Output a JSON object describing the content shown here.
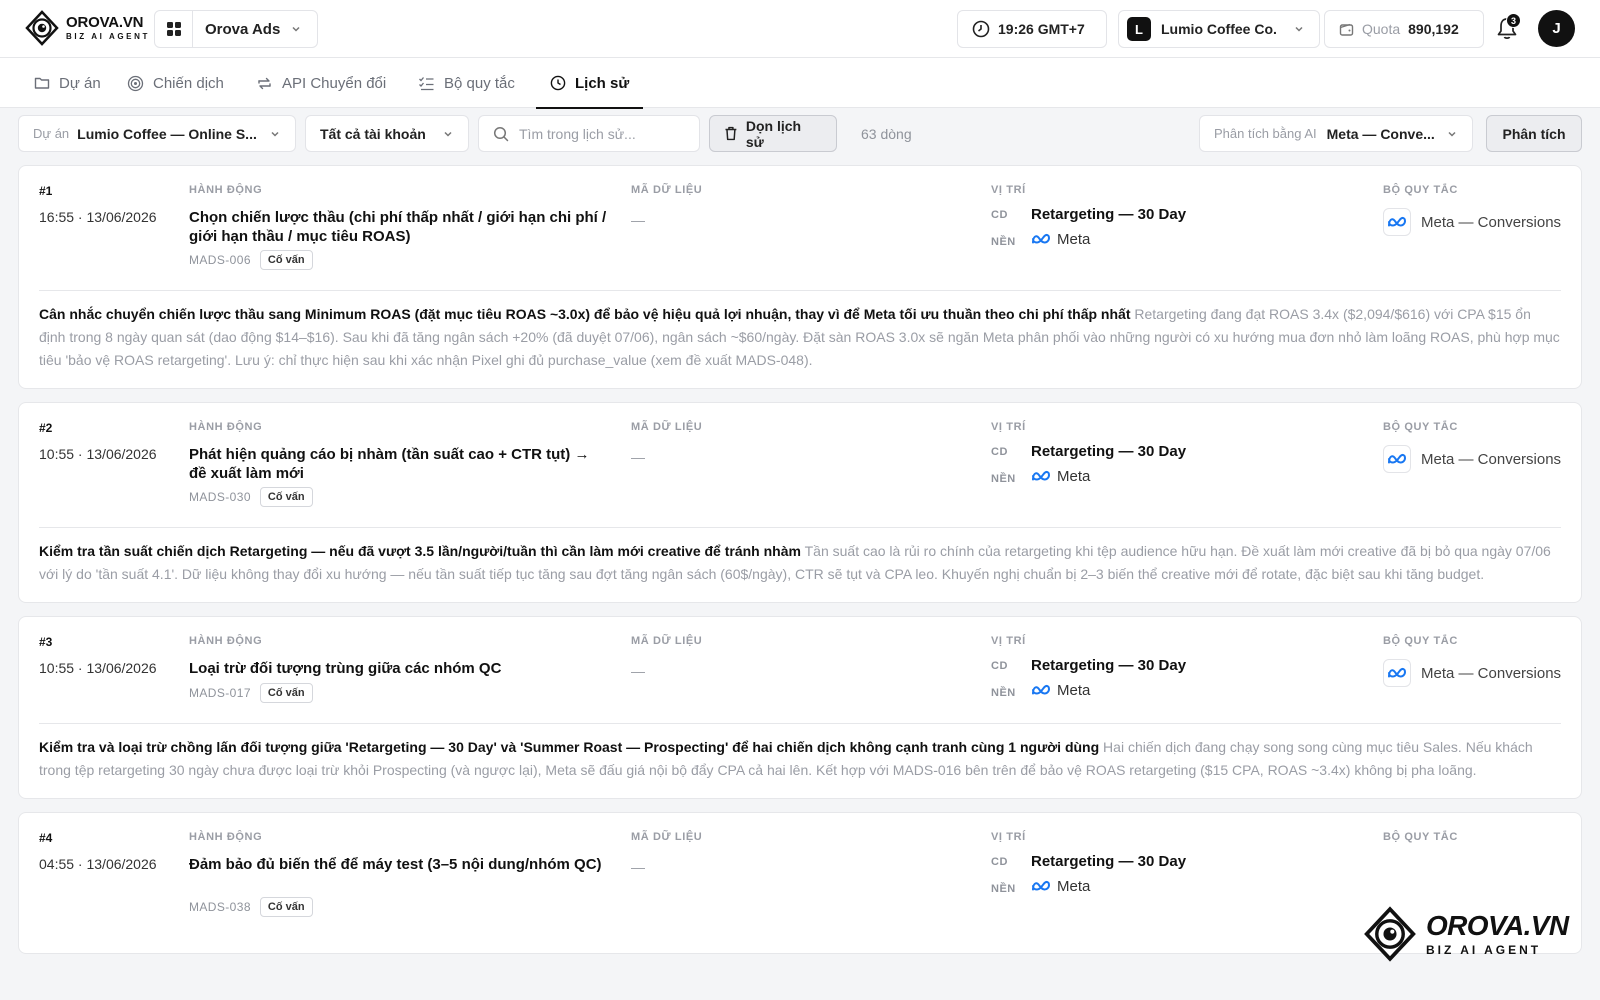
{
  "header": {
    "brand": "OROVA.VN",
    "brand_sub": "BIZ AI AGENT",
    "app_name": "Orova Ads",
    "clock": "19:26  GMT+7",
    "account_initial": "L",
    "account_name": "Lumio Coffee Co.",
    "quota_label": "Quota",
    "quota_value": "890,192",
    "notification_count": "3",
    "user_initial": "J"
  },
  "tabs": [
    {
      "label": "Dự án",
      "icon": "folder-icon"
    },
    {
      "label": "Chiến dịch",
      "icon": "target-icon"
    },
    {
      "label": "API Chuyển đổi",
      "icon": "sync-icon"
    },
    {
      "label": "Bộ quy tắc",
      "icon": "checklist-icon"
    },
    {
      "label": "Lịch sử",
      "icon": "clock-icon",
      "active": true
    }
  ],
  "filters": {
    "project_label": "Dự án",
    "project_value": "Lumio Coffee — Online S...",
    "accounts_value": "Tất cả tài khoản",
    "search_placeholder": "Tìm trong lịch sử...",
    "clear_label": "Dọn lịch sử",
    "row_count": "63 dòng",
    "ai_label": "Phân tích bằng AI",
    "ai_value": "Meta — Conve...",
    "analyze_label": "Phân tích"
  },
  "columns": {
    "action": "HÀNH ĐỘNG",
    "data_code": "MÃ DỮ LIỆU",
    "position": "VỊ TRÍ",
    "ruleset": "BỘ QUY TẮC",
    "campaign_key": "CD",
    "platform_key": "NỀN"
  },
  "entries": [
    {
      "num": "#1",
      "time": "16:55 · 13/06/2026",
      "action": "Chọn chiến lược thầu (chi phí thấp nhất / giới hạn chi phí / giới hạn thầu / mục tiêu ROAS)",
      "code": "MADS-006",
      "tag": "Cố vấn",
      "data_code": "—",
      "campaign": "Retargeting — 30 Day",
      "platform": "Meta",
      "ruleset": "Meta — Conversions",
      "summary": "Cân nhắc chuyển chiến lược thầu sang Minimum ROAS (đặt mục tiêu ROAS ~3.0x) để bảo vệ hiệu quả lợi nhuận, thay vì để Meta tối ưu thuần theo chi phí thấp nhất",
      "detail": "Retargeting đang đạt ROAS 3.4x ($2,094/$616) với CPA $15 ổn định trong 8 ngày quan sát (dao động $14–$16). Sau khi đã tăng ngân sách +20% (đã duyệt 07/06), ngân sách ~$60/ngày. Đặt sàn ROAS 3.0x sẽ ngăn Meta phân phối vào những người có xu hướng mua đơn nhỏ làm loãng ROAS, phù hợp mục tiêu 'bảo vệ ROAS retargeting'. Lưu ý: chỉ thực hiện sau khi xác nhận Pixel ghi đủ purchase_value (xem đề xuất MADS-048)."
    },
    {
      "num": "#2",
      "time": "10:55 · 13/06/2026",
      "action": "Phát hiện quảng cáo bị nhàm (tần suất cao + CTR tụt) → đề xuất làm mới",
      "code": "MADS-030",
      "tag": "Cố vấn",
      "data_code": "—",
      "campaign": "Retargeting — 30 Day",
      "platform": "Meta",
      "ruleset": "Meta — Conversions",
      "summary": "Kiểm tra tần suất chiến dịch Retargeting — nếu đã vượt 3.5 lần/người/tuần thì cần làm mới creative để tránh nhàm",
      "detail": "Tần suất cao là rủi ro chính của retargeting khi tệp audience hữu hạn. Đề xuất làm mới creative đã bị bỏ qua ngày 07/06 với lý do 'tần suất 4.1'. Dữ liệu không thay đổi xu hướng — nếu tần suất tiếp tục tăng sau đợt tăng ngân sách (60$/ngày), CTR sẽ tụt và CPA leo. Khuyến nghị chuẩn bị 2–3 biến thể creative mới để rotate, đặc biệt sau khi tăng budget."
    },
    {
      "num": "#3",
      "time": "10:55 · 13/06/2026",
      "action": "Loại trừ đối tượng trùng giữa các nhóm QC",
      "code": "MADS-017",
      "tag": "Cố vấn",
      "data_code": "—",
      "campaign": "Retargeting — 30 Day",
      "platform": "Meta",
      "ruleset": "Meta — Conversions",
      "summary": "Kiểm tra và loại trừ chồng lấn đối tượng giữa 'Retargeting — 30 Day' và 'Summer Roast — Prospecting' để hai chiến dịch không cạnh tranh cùng 1 người dùng",
      "detail": "Hai chiến dịch đang chạy song song cùng mục tiêu Sales. Nếu khách trong tệp retargeting 30 ngày chưa được loại trừ khỏi Prospecting (và ngược lại), Meta sẽ đấu giá nội bộ đẩy CPA cả hai lên. Kết hợp với MADS-016 bên trên để bảo vệ ROAS retargeting ($15 CPA, ROAS ~3.4x) không bị pha loãng."
    },
    {
      "num": "#4",
      "time": "04:55 · 13/06/2026",
      "action": "Đảm bảo đủ biến thể để máy test (3–5 nội dung/nhóm QC)",
      "code": "MADS-038",
      "tag": "Cố vấn",
      "data_code": "—",
      "campaign": "Retargeting — 30 Day",
      "platform": "Meta",
      "ruleset": "",
      "summary": "",
      "detail": ""
    }
  ],
  "watermark": {
    "name": "OROVA.VN",
    "sub": "BIZ AI AGENT"
  }
}
